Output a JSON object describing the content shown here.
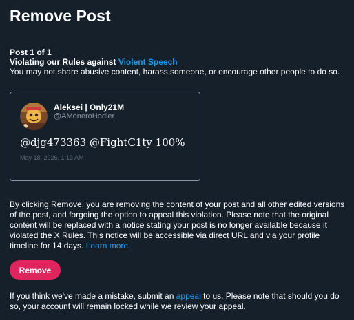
{
  "page": {
    "title": "Remove Post"
  },
  "violation": {
    "post_count": "Post 1 of 1",
    "violation_prefix": "Violating our Rules against ",
    "rule_link": "Violent Speech",
    "rule_description": "You may not share abusive content, harass someone, or encourage other people to do so."
  },
  "post": {
    "author_name": "Aleksei | Only21M",
    "author_handle": "@AMoneroHodler",
    "text": "@djg473363 @FightC1ty 100%",
    "date": "May 18, 2026, 1:13 AM"
  },
  "explanation": {
    "text": "By clicking Remove, you are removing the content of your post and all other edited versions of the post, and forgoing the option to appeal this violation. Please note that the original content will be replaced with a notice stating your post is no longer available because it violated the X Rules. This notice will be accessible via direct URL and via your profile timeline for 14 days. ",
    "learn_more": "Learn more."
  },
  "actions": {
    "remove_label": "Remove"
  },
  "appeal": {
    "prefix": "If you think we've made a mistake, submit an ",
    "link": "appeal",
    "suffix": " to us. Please note that should you do so, your account will remain locked while we review your appeal."
  },
  "colors": {
    "background": "#15202b",
    "link": "#1d9bf0",
    "remove_button": "#e0245e"
  }
}
